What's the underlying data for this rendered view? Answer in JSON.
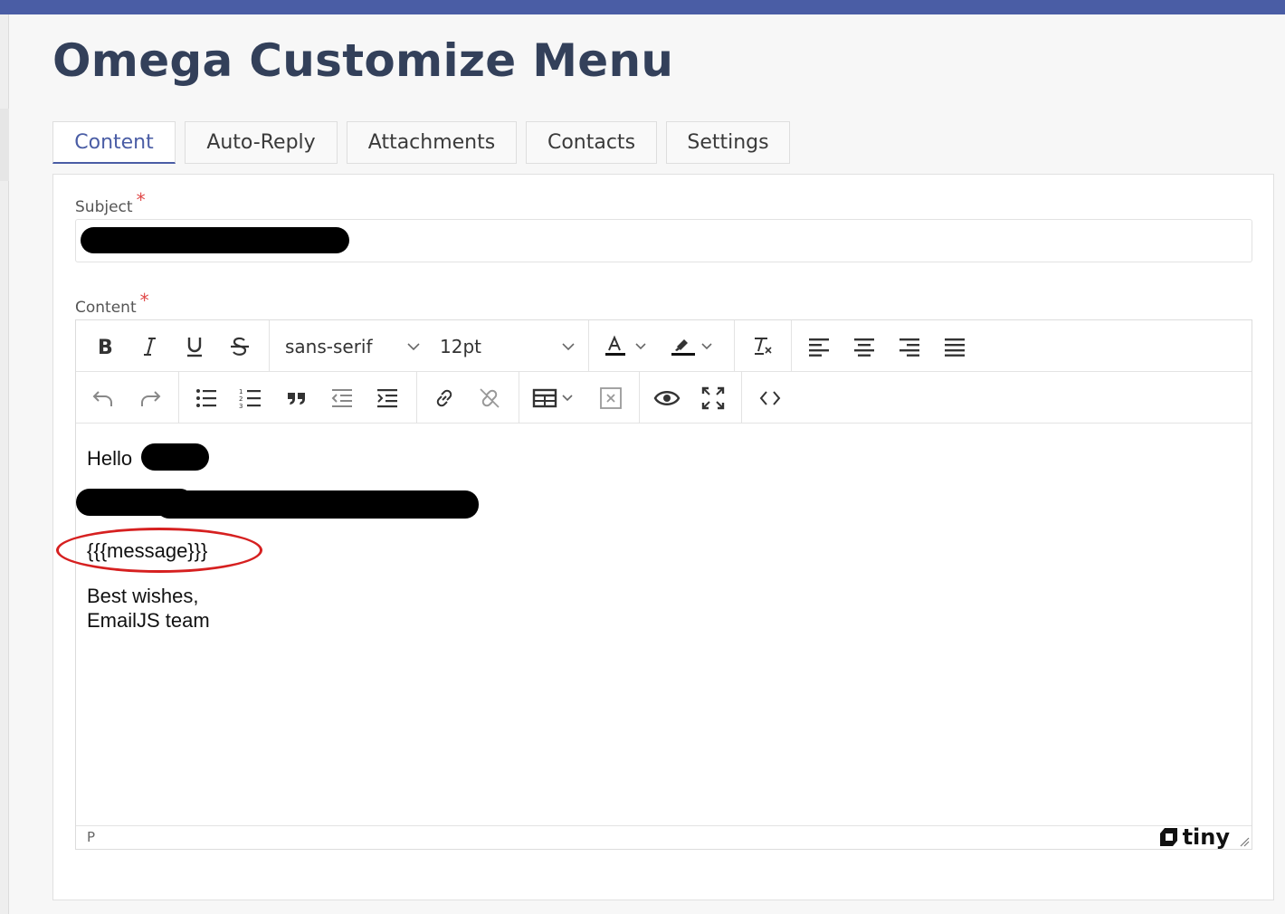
{
  "header": {
    "title": "Omega Customize Menu"
  },
  "tabs": [
    {
      "label": "Content",
      "active": true
    },
    {
      "label": "Auto-Reply",
      "active": false
    },
    {
      "label": "Attachments",
      "active": false
    },
    {
      "label": "Contacts",
      "active": false
    },
    {
      "label": "Settings",
      "active": false
    }
  ],
  "form": {
    "subject_label": "Subject",
    "subject_value": "",
    "content_label": "Content",
    "required_mark": "*"
  },
  "toolbar": {
    "font_family": "sans-serif",
    "font_size": "12pt",
    "row1_icons": [
      "bold-icon",
      "italic-icon",
      "underline-icon",
      "strikethrough-icon",
      "text-color-icon",
      "highlight-icon",
      "clear-formatting-icon",
      "align-left-icon",
      "align-center-icon",
      "align-right-icon",
      "justify-icon"
    ],
    "row2_icons": [
      "undo-icon",
      "redo-icon",
      "bullet-list-icon",
      "numbered-list-icon",
      "blockquote-icon",
      "outdent-icon",
      "indent-icon",
      "link-icon",
      "unlink-icon",
      "table-icon",
      "remove-table-icon",
      "preview-icon",
      "fullscreen-icon",
      "source-code-icon"
    ]
  },
  "editor": {
    "greeting": "Hello",
    "placeholder_tag": "{{{message}}}",
    "signoff": "Best wishes,",
    "signature": "EmailJS team",
    "status_path": "P",
    "brand": "tiny"
  },
  "colors": {
    "accent": "#4a5da5",
    "title": "#33405a",
    "annotation": "#d62020"
  }
}
